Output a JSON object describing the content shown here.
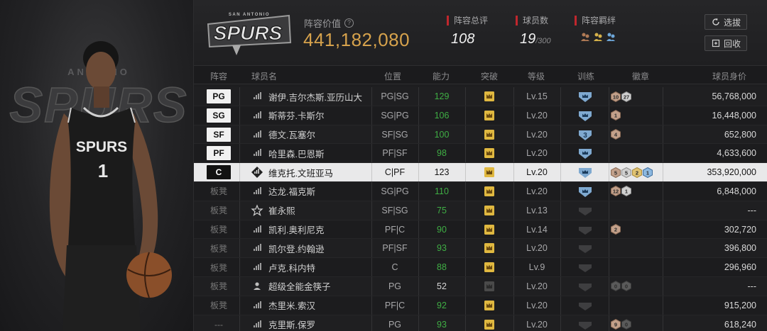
{
  "team": {
    "logo_text": "SPURS",
    "logo_sub": "SAN ANTONIO",
    "bg_word": "SPURS",
    "bg_sub": "ANTONIO",
    "jersey_text": "SPURS",
    "jersey_number": "1"
  },
  "header": {
    "value_label": "阵容价值",
    "value": "441,182,080",
    "rating_label": "阵容总评",
    "rating": "108",
    "count_label": "球员数",
    "count": "19",
    "count_max": "/300",
    "bonds_label": "阵容羁绊",
    "select_btn": "选拔",
    "recycle_btn": "回收"
  },
  "columns": {
    "lineup": "阵容",
    "name": "球员名",
    "position": "位置",
    "ability": "能力",
    "breakthrough": "突破",
    "level": "等级",
    "training": "训练",
    "badges": "徽章",
    "value": "球员身价"
  },
  "rows": [
    {
      "slot": "PG",
      "bench": false,
      "name": "谢伊.吉尔杰斯.亚历山大",
      "pos": "PG|SG",
      "ability": "129",
      "ability_boosted": true,
      "level": "Lv.15",
      "train": "crown",
      "badges": [
        {
          "t": "10",
          "c": "bronze"
        },
        {
          "t": "27",
          "c": "silver"
        }
      ],
      "value": "56,768,000",
      "icon": "signal"
    },
    {
      "slot": "SG",
      "bench": false,
      "name": "斯蒂芬.卡斯尔",
      "pos": "SG|PG",
      "ability": "106",
      "ability_boosted": true,
      "level": "Lv.20",
      "train": "crown",
      "badges": [
        {
          "t": "1",
          "c": "bronze"
        }
      ],
      "value": "16,448,000",
      "icon": "signal"
    },
    {
      "slot": "SF",
      "bench": false,
      "name": "德文.瓦塞尔",
      "pos": "SF|SG",
      "ability": "100",
      "ability_boosted": true,
      "level": "Lv.20",
      "train": "num",
      "train_text": "3",
      "badges": [
        {
          "t": "4",
          "c": "bronze"
        }
      ],
      "value": "652,800",
      "icon": "signal"
    },
    {
      "slot": "PF",
      "bench": false,
      "name": "哈里森.巴恩斯",
      "pos": "PF|SF",
      "ability": "98",
      "ability_boosted": true,
      "level": "Lv.20",
      "train": "crown",
      "badges": [],
      "value": "4,633,600",
      "icon": "signal"
    },
    {
      "slot": "C",
      "bench": false,
      "selected": true,
      "name": "维克托.文班亚马",
      "pos": "C|PF",
      "ability": "123",
      "ability_boosted": false,
      "level": "Lv.20",
      "train": "crown",
      "badges": [
        {
          "t": "5",
          "c": "bronze"
        },
        {
          "t": "5",
          "c": "silver"
        },
        {
          "t": "2",
          "c": "gold"
        },
        {
          "t": "1",
          "c": "blue"
        }
      ],
      "value": "353,920,000",
      "icon": "diamond"
    },
    {
      "slot": "板凳",
      "bench": true,
      "name": "达龙.福克斯",
      "pos": "SG|PG",
      "ability": "110",
      "ability_boosted": true,
      "level": "Lv.20",
      "train": "crown",
      "badges": [
        {
          "t": "12",
          "c": "bronze"
        },
        {
          "t": "1",
          "c": "silver"
        }
      ],
      "value": "6,848,000",
      "icon": "signal"
    },
    {
      "slot": "板凳",
      "bench": true,
      "name": "崔永熙",
      "pos": "SF|SG",
      "ability": "75",
      "ability_boosted": true,
      "level": "Lv.13",
      "train": "dim",
      "badges": [],
      "value": "---",
      "icon": "star"
    },
    {
      "slot": "板凳",
      "bench": true,
      "name": "凯利.奥利尼克",
      "pos": "PF|C",
      "ability": "90",
      "ability_boosted": true,
      "level": "Lv.14",
      "train": "dim",
      "badges": [
        {
          "t": "2",
          "c": "bronze"
        }
      ],
      "value": "302,720",
      "icon": "signal"
    },
    {
      "slot": "板凳",
      "bench": true,
      "name": "凯尔登.约翰逊",
      "pos": "PF|SF",
      "ability": "93",
      "ability_boosted": true,
      "level": "Lv.20",
      "train": "dim",
      "badges": [],
      "value": "396,800",
      "icon": "signal"
    },
    {
      "slot": "板凳",
      "bench": true,
      "name": "卢克.科内特",
      "pos": "C",
      "ability": "88",
      "ability_boosted": true,
      "level": "Lv.9",
      "train": "dim",
      "badges": [],
      "value": "296,960",
      "icon": "signal"
    },
    {
      "slot": "板凳",
      "bench": true,
      "name": "超级全能金筷子",
      "pos": "PG",
      "ability": "52",
      "ability_boosted": false,
      "level": "Lv.20",
      "train": "dim",
      "crown_dim": true,
      "badges": [
        {
          "t": "0",
          "c": "dark"
        },
        {
          "t": "0",
          "c": "dark"
        }
      ],
      "value": "---",
      "icon": "person"
    },
    {
      "slot": "板凳",
      "bench": true,
      "name": "杰里米.索汉",
      "pos": "PF|C",
      "ability": "92",
      "ability_boosted": true,
      "level": "Lv.20",
      "train": "dim",
      "badges": [],
      "value": "915,200",
      "icon": "signal"
    },
    {
      "slot": "---",
      "bench": true,
      "name": "克里斯.保罗",
      "pos": "PG",
      "ability": "93",
      "ability_boosted": true,
      "level": "Lv.20",
      "train": "dim",
      "badges": [
        {
          "t": "9",
          "c": "bronze"
        },
        {
          "t": "0",
          "c": "dark"
        }
      ],
      "value": "618,240",
      "icon": "signal"
    }
  ],
  "colors": {
    "gold": "#d6a24c",
    "green": "#3fae44",
    "red_accent": "#c0272d",
    "train_blue": "#8fb6d8"
  }
}
